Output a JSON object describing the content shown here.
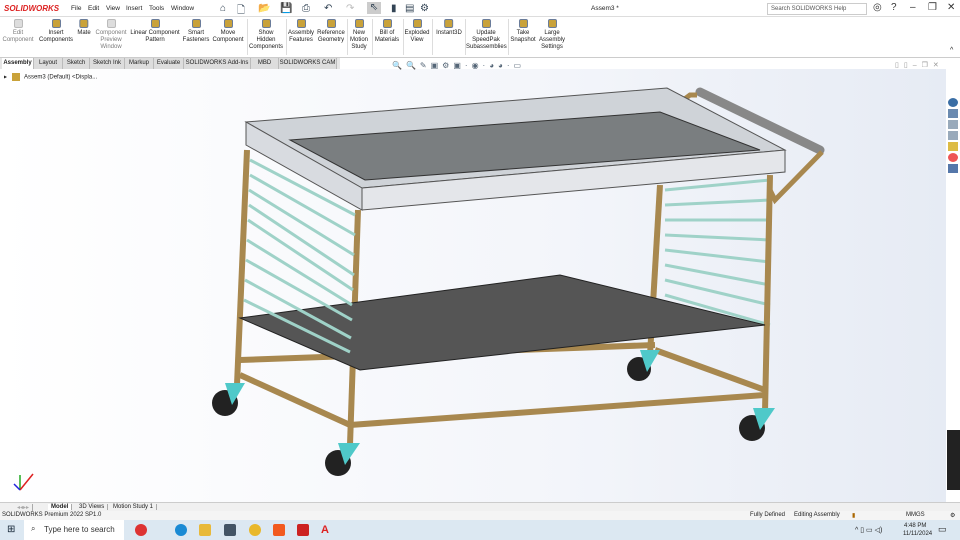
{
  "app": {
    "logo": "SOLIDWORKS",
    "title": "Assem3 *",
    "search_placeholder": "Search SOLIDWORKS Help"
  },
  "menu": [
    "File",
    "Edit",
    "View",
    "Insert",
    "Tools",
    "Window"
  ],
  "ribbon": [
    {
      "label": "Edit Component",
      "disabled": true
    },
    {
      "label": "Insert Components"
    },
    {
      "label": "Mate"
    },
    {
      "label": "Component Preview Window",
      "disabled": true
    },
    {
      "label": "Linear Component Pattern"
    },
    {
      "label": "Smart Fasteners"
    },
    {
      "label": "Move Component"
    },
    {
      "label": "Show Hidden Components"
    },
    {
      "label": "Assembly Features"
    },
    {
      "label": "Reference Geometry"
    },
    {
      "label": "New Motion Study"
    },
    {
      "label": "Bill of Materials"
    },
    {
      "label": "Exploded View"
    },
    {
      "label": "Instant3D"
    },
    {
      "label": "Update SpeedPak Subassemblies"
    },
    {
      "label": "Take Snapshot"
    },
    {
      "label": "Large Assembly Settings"
    }
  ],
  "tabs": [
    "Assembly",
    "Layout",
    "Sketch",
    "Sketch Ink",
    "Markup",
    "Evaluate",
    "SOLIDWORKS Add-Ins",
    "MBD",
    "SOLIDWORKS CAM"
  ],
  "active_tab": "Assembly",
  "tree": {
    "root": "Assem3 (Default) <Displa..."
  },
  "bottom_tabs": [
    "Model",
    "3D Views",
    "Motion Study 1"
  ],
  "status": {
    "product": "SOLIDWORKS Premium 2022 SP1.0",
    "state": "Fully Defined",
    "mode": "Editing Assembly",
    "units": "MMGS"
  },
  "taskbar": {
    "search_placeholder": "Type here to search",
    "time": "4:48 PM",
    "date": "11/11/2024"
  },
  "colors": {
    "frame": "#a8884f",
    "caster": "#4fc9c9",
    "glass": "#9fd2c8",
    "tray": "#cfd3d8"
  }
}
